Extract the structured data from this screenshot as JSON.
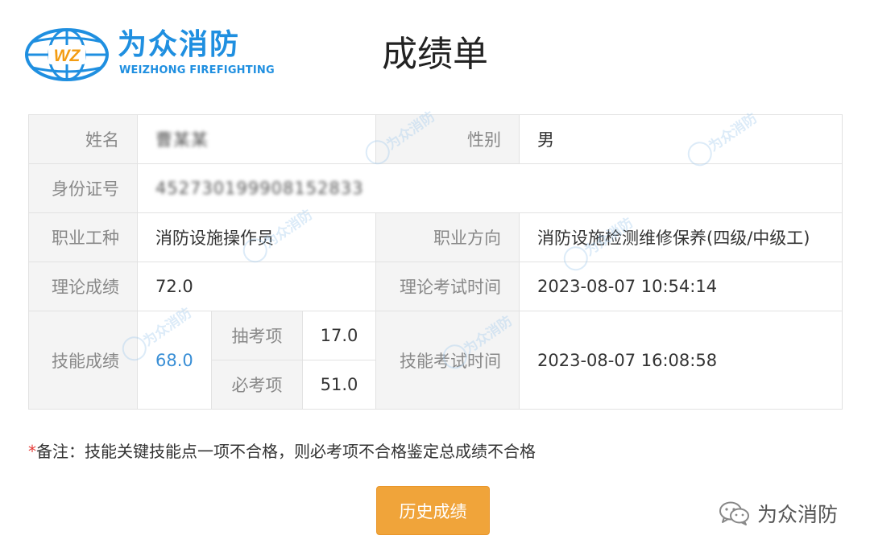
{
  "header": {
    "logo_badge": "WZ",
    "logo_cn": "为众消防",
    "logo_en": "WEIZHONG FIREFIGHTING",
    "title": "成绩单"
  },
  "record": {
    "name_label": "姓名",
    "name_value": "曹某某",
    "gender_label": "性别",
    "gender_value": "男",
    "id_label": "身份证号",
    "id_value": "452730199908152833",
    "occupation_label": "职业工种",
    "occupation_value": "消防设施操作员",
    "direction_label": "职业方向",
    "direction_value": "消防设施检测维修保养(四级/中级工)",
    "theory_label": "理论成绩",
    "theory_value": "72.0",
    "theory_time_label": "理论考试时间",
    "theory_time_value": "2023-08-07 10:54:14",
    "skill_label": "技能成绩",
    "skill_value": "68.0",
    "random_item_label": "抽考项",
    "random_item_value": "17.0",
    "required_item_label": "必考项",
    "required_item_value": "51.0",
    "skill_time_label": "技能考试时间",
    "skill_time_value": "2023-08-07 16:08:58"
  },
  "watermark_text": "为众消防",
  "note": {
    "star": "*",
    "text": "备注：技能关键技能点一项不合格，则必考项不合格鉴定总成绩不合格"
  },
  "history_button_label": "历史成绩",
  "footer": {
    "icon": "wechat-icon",
    "brand": "为众消防"
  },
  "colors": {
    "brand_blue": "#1f8fe0",
    "button_orange": "#f0a43a",
    "label_bg": "#f4f4f4",
    "link_blue": "#3a8fd6",
    "required_star": "#e53935"
  }
}
